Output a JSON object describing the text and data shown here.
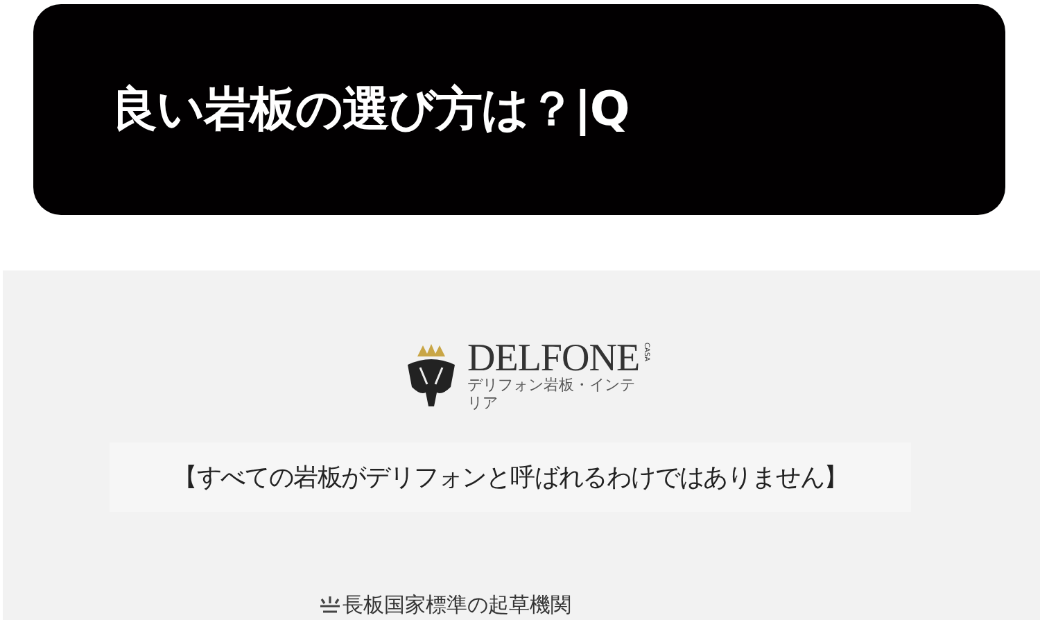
{
  "banner": {
    "title": "良い岩板の選び方は？|Q"
  },
  "logo": {
    "brand": "DELFONE",
    "tag": "CASA",
    "subtitle": "デリフォン岩板・インテリア"
  },
  "heading": "【すべての岩板がデリフォンと呼ばれるわけではありません】",
  "section_title": "長板国家標準の起草機関"
}
